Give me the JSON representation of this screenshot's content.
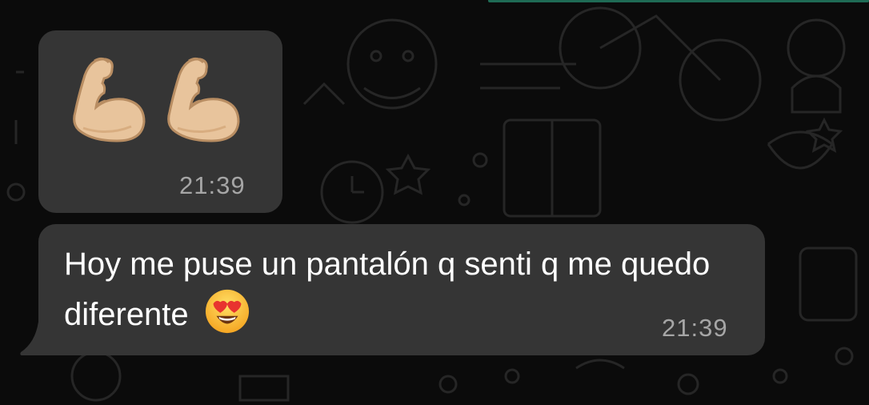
{
  "chat": {
    "messages": [
      {
        "type": "emoji",
        "emojis": [
          "flexed-biceps-icon",
          "flexed-biceps-icon"
        ],
        "time": "21:39"
      },
      {
        "type": "text",
        "text": "Hoy me puse un pantalón q senti q me quedo diferente",
        "emoji": "heart-eyes-icon",
        "time": "21:39"
      }
    ]
  },
  "colors": {
    "background": "#0b0b0b",
    "bubble": "#353535",
    "text": "#ffffff",
    "timestamp": "#a6a6a6",
    "accent": "#1f6b55"
  }
}
